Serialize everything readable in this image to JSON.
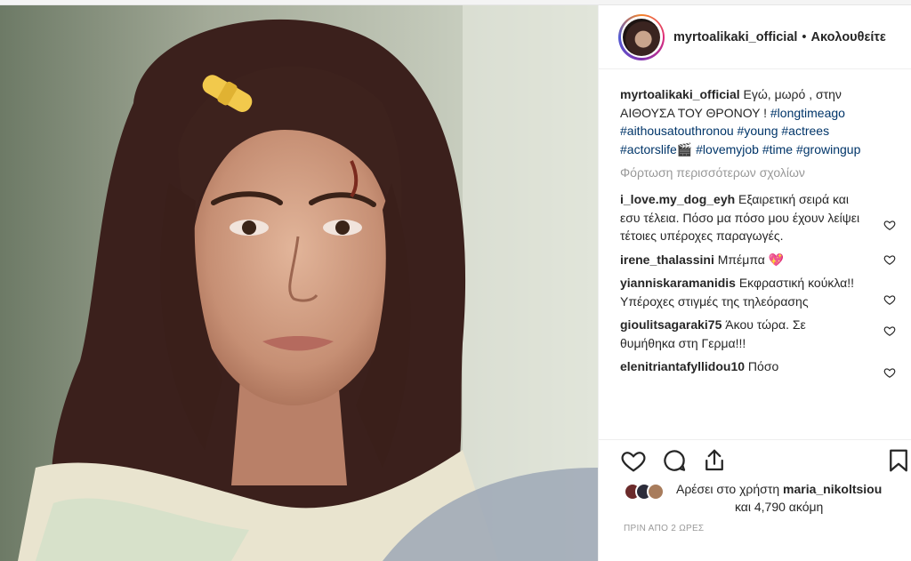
{
  "post": {
    "username": "myrtoalikaki_official",
    "follow_label": "Ακολουθείτε",
    "separator": "•"
  },
  "caption": {
    "user": "myrtoalikaki_official",
    "text": "Εγώ, μωρό , στην ΑΙΘΟΥΣΑ ΤΟΥ ΘΡΟΝΟΥ ! ",
    "tags_line1": "#longtimeago",
    "tags_line2": "#aithousatouthronou #young #actrees",
    "tags_line3a": "#actorslife🎬",
    "tags_line3b": " #lovemyjob #time",
    "tags_line4": "#growingup"
  },
  "load_more": "Φόρτωση περισσότερων σχολίων",
  "comments": [
    {
      "user": "i_love.my_dog_eyh",
      "text": " Εξαιρετική σειρά και εσυ τέλεια. Πόσο μα πόσο μου έχουν λείψει τέτοιες υπέροχες παραγωγές."
    },
    {
      "user": "irene_thalassini",
      "text": " Μπέμπα 💖"
    },
    {
      "user": "yianniskaramanidis",
      "text": " Εκφραστική κούκλα!! Υπέροχες στιγμές της τηλεόρασης"
    },
    {
      "user": "gioulitsagaraki75",
      "text": " Άκου τώρα. Σε θυμήθηκα στη Γερμα!!!"
    },
    {
      "user": "elenitriantafyllidou10",
      "text": " Πόσο"
    }
  ],
  "likes": {
    "prefix": "Αρέσει στο χρήστη ",
    "user": "maria_nikoltsiou",
    "line2": "και 4,790 ακόμη"
  },
  "timestamp": "ΠΡΙΝ ΑΠΟ 2 ΩΡΕΣ",
  "icons": [
    "heart-icon",
    "comment-icon",
    "share-icon",
    "bookmark-icon"
  ]
}
